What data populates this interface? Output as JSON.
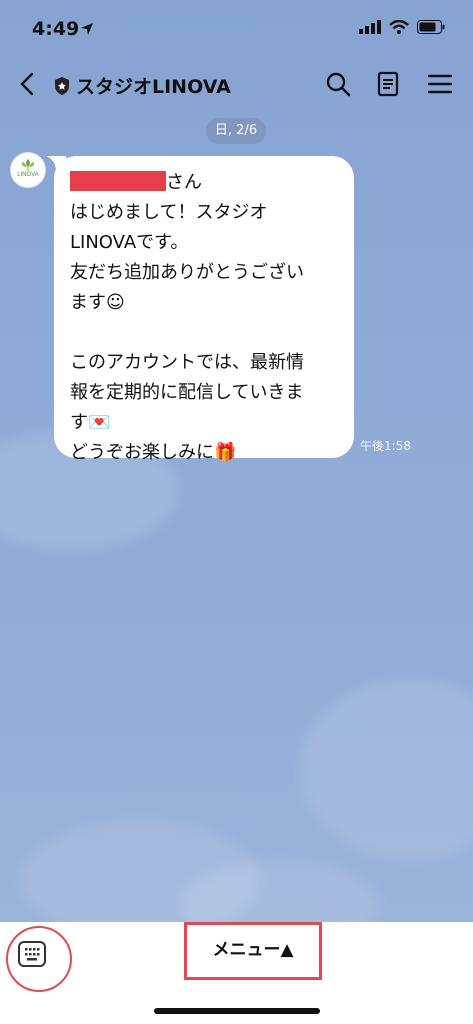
{
  "status_bar": {
    "time": "4:49"
  },
  "header": {
    "title": "スタジオLINOVA",
    "back_icon": "chevron-left-icon",
    "search_icon": "search-icon",
    "notes_icon": "notes-icon",
    "menu_icon": "hamburger-icon"
  },
  "chat": {
    "date_label": "日, 2/6",
    "avatar_text": "LINOVA",
    "message": {
      "name_suffix": "さん",
      "body": "はじめまして！スタジオ\nLINOVAです。\n友だち追加ありがとうござい\nます☺\n\nこのアカウントでは、最新情\n報を定期的に配信していきま\nす💌\nどうぞお楽しみに🎁",
      "time": "午後1:58"
    }
  },
  "bottom_bar": {
    "menu_label": "メニュー▲",
    "keyboard_icon": "keyboard-icon"
  }
}
